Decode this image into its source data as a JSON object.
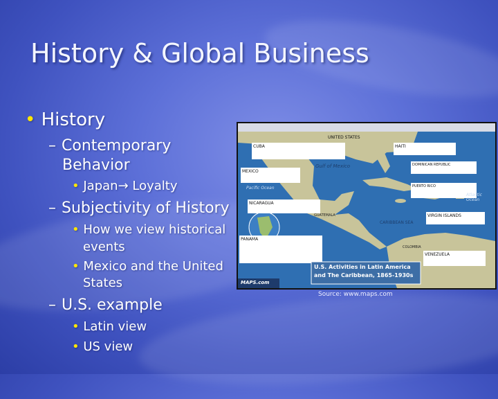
{
  "slide": {
    "title": "History & Global Business",
    "bullets": {
      "history": "History",
      "contemporary": "Contemporary",
      "behavior": "Behavior",
      "japan_prefix": "Japan",
      "japan_suffix": "Loyalty",
      "subjectivity": "Subjectivity of History",
      "how_we_view_1": "How we view historical",
      "how_we_view_2": "events",
      "mexico_us_1": "Mexico and the United",
      "mexico_us_2": "States",
      "us_example": "U.S. example",
      "latin_view": "Latin view",
      "us_view": "US view"
    },
    "source": "Source: www.maps.com"
  },
  "map": {
    "title_line1": "U.S. Activities in Latin America",
    "title_line2": "and The Caribbean, 1865-1930s",
    "labels": {
      "united_states": "UNITED STATES",
      "mexico": "MEXICO",
      "cuba": "CUBA",
      "haiti": "HAITI",
      "dominican_republic": "DOMINICAN REPUBLIC",
      "puerto_rico": "PUERTO RICO",
      "nicaragua": "NICARAGUA",
      "panama": "PANAMA",
      "venezuela": "VENEZUELA",
      "colombia": "COLOMBIA",
      "guatemala": "GUATEMALA",
      "virgin_islands": "VIRGIN ISLANDS",
      "gulf_of_mexico": "Gulf of Mexico",
      "pacific_ocean": "Pacific Ocean",
      "atlantic_ocean": "Atlantic Ocean",
      "caribbean_sea": "CARIBBEAN SEA",
      "brand": "MAPS.com"
    },
    "colors": {
      "water": "#2f6fb2",
      "land": "#c8c49a",
      "panel": "#ffffff"
    }
  }
}
